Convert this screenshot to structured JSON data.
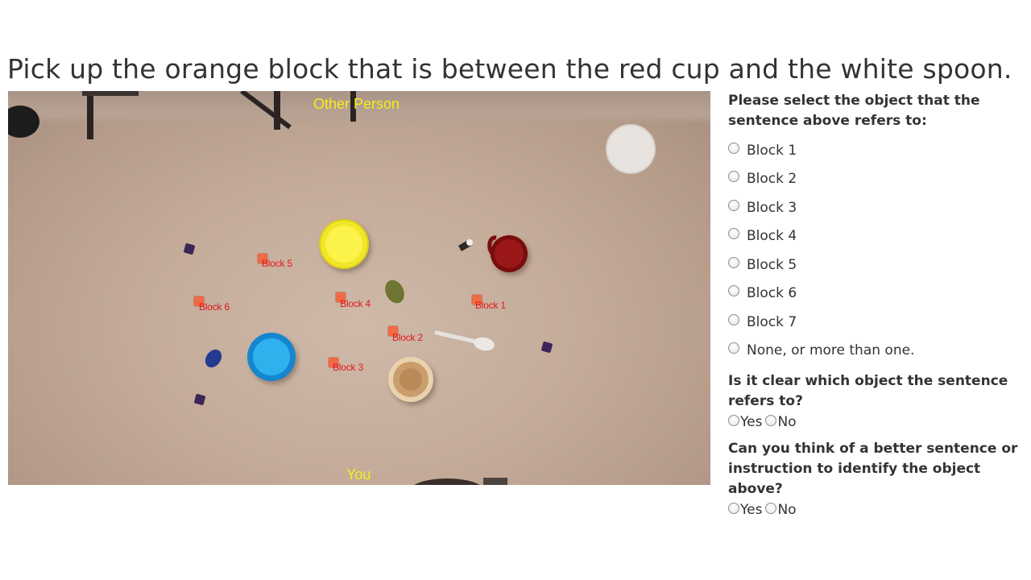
{
  "instruction": "Pick up the orange block that is between the red cup and the white spoon.",
  "scene": {
    "top_label": "Other Person",
    "bottom_label": "You",
    "block_labels": [
      "Block 1",
      "Block 2",
      "Block 3",
      "Block 4",
      "Block 5",
      "Block 6"
    ],
    "colors": {
      "label_yellow": "#f4ee1c",
      "label_red": "#e3161a",
      "orange_block": "#f06a45",
      "purple_block": "#3d2558",
      "yellow_bowl": "#f2e629",
      "blue_bowl": "#1fa0e0",
      "wood_bowl": "#d8b58a",
      "red_cup": "#8e1111"
    }
  },
  "question1": {
    "title": "Please select the object that the sentence above refers to:",
    "options": [
      "Block 1",
      "Block 2",
      "Block 3",
      "Block 4",
      "Block 5",
      "Block 6",
      "Block 7",
      "None, or more than one."
    ]
  },
  "question2": {
    "title": "Is it clear which object the sentence refers to?",
    "yes": "Yes",
    "no": "No"
  },
  "question3": {
    "title": "Can you think of a better sentence or instruction to identify the object above?",
    "yes": "Yes",
    "no": "No"
  }
}
